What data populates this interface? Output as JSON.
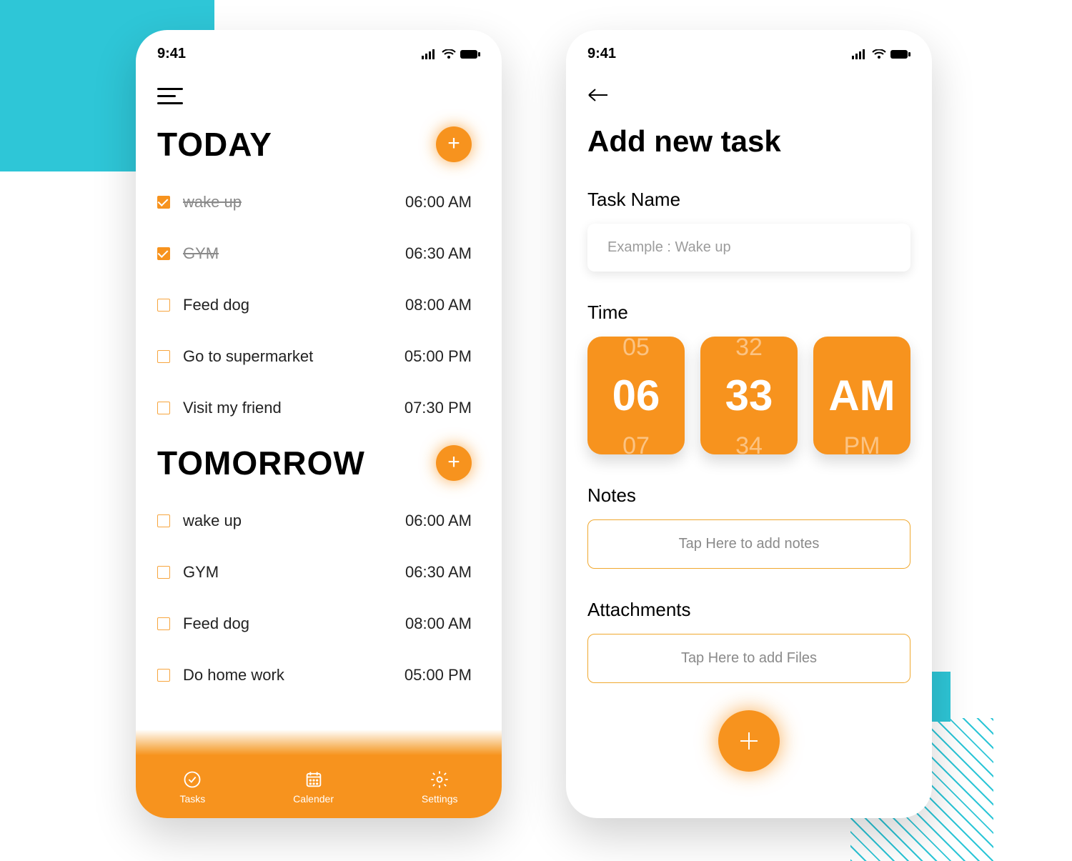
{
  "colors": {
    "accent": "#f7931e",
    "cyan": "#2ec6d7"
  },
  "status_time": "9:41",
  "left": {
    "sections": {
      "today": {
        "title": "TODAY",
        "add_label": "+",
        "tasks": [
          {
            "label": "wake up",
            "time": "06:00 AM",
            "done": true
          },
          {
            "label": "GYM",
            "time": "06:30 AM",
            "done": true
          },
          {
            "label": "Feed dog",
            "time": "08:00 AM",
            "done": false
          },
          {
            "label": "Go to supermarket",
            "time": "05:00 PM",
            "done": false
          },
          {
            "label": "Visit my friend",
            "time": "07:30 PM",
            "done": false
          }
        ]
      },
      "tomorrow": {
        "title": "TOMORROW",
        "add_label": "+",
        "tasks": [
          {
            "label": "wake up",
            "time": "06:00 AM",
            "done": false
          },
          {
            "label": "GYM",
            "time": "06:30 AM",
            "done": false
          },
          {
            "label": "Feed dog",
            "time": "08:00 AM",
            "done": false
          },
          {
            "label": "Do home work",
            "time": "05:00 PM",
            "done": false
          }
        ]
      }
    },
    "nav": {
      "tasks": "Tasks",
      "calendar": "Calender",
      "settings": "Settings"
    }
  },
  "right": {
    "title": "Add new task",
    "task_name_label": "Task Name",
    "task_name_placeholder": "Example : Wake up",
    "time_label": "Time",
    "time_picker": {
      "hour": {
        "prev": "05",
        "value": "06",
        "next": "07"
      },
      "minute": {
        "prev": "32",
        "value": "33",
        "next": "34"
      },
      "ampm": {
        "value": "AM",
        "next": "PM"
      }
    },
    "notes_label": "Notes",
    "notes_placeholder": "Tap Here to add notes",
    "attachments_label": "Attachments",
    "attachments_placeholder": "Tap Here to add Files"
  }
}
